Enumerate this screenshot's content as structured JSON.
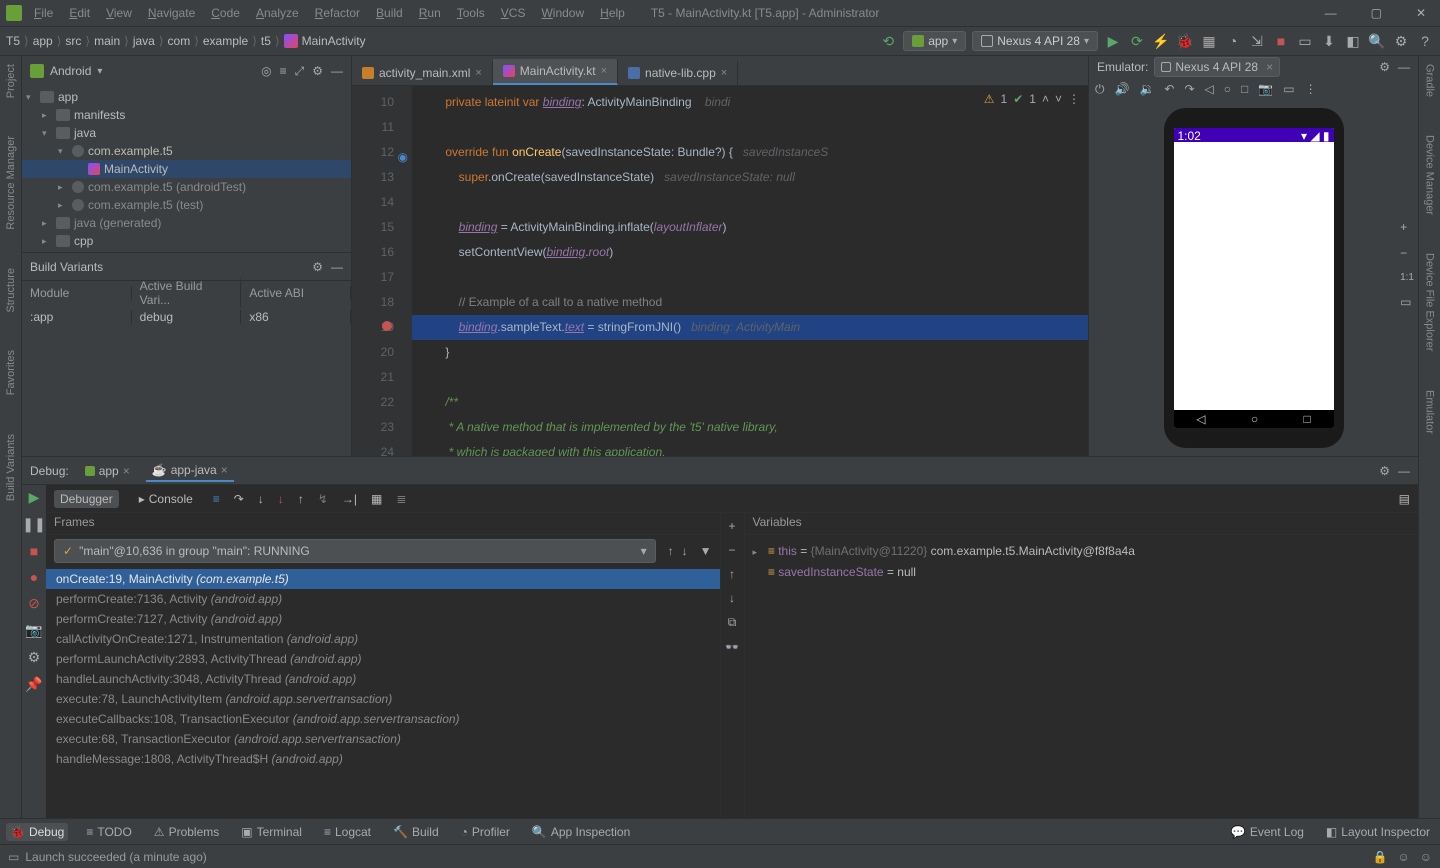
{
  "window": {
    "title": "T5 - MainActivity.kt [T5.app] - Administrator"
  },
  "menubar": [
    "File",
    "Edit",
    "View",
    "Navigate",
    "Code",
    "Analyze",
    "Refactor",
    "Build",
    "Run",
    "Tools",
    "VCS",
    "Window",
    "Help"
  ],
  "breadcrumbs": [
    "T5",
    "app",
    "src",
    "main",
    "java",
    "com",
    "example",
    "t5",
    "MainActivity"
  ],
  "run_config": {
    "app": "app",
    "device": "Nexus 4 API 28"
  },
  "project": {
    "header": "Android",
    "tree": [
      {
        "label": "app",
        "icon": "folder",
        "depth": 0,
        "open": true
      },
      {
        "label": "manifests",
        "icon": "folder",
        "depth": 1,
        "open": false
      },
      {
        "label": "java",
        "icon": "folder",
        "depth": 1,
        "open": true
      },
      {
        "label": "com.example.t5",
        "icon": "pkg",
        "depth": 2,
        "open": true
      },
      {
        "label": "MainActivity",
        "icon": "kfile",
        "depth": 3,
        "open": false,
        "sel": true
      },
      {
        "label": "com.example.t5 (androidTest)",
        "icon": "pkg",
        "depth": 2,
        "open": false,
        "dim": true
      },
      {
        "label": "com.example.t5 (test)",
        "icon": "pkg",
        "depth": 2,
        "open": false,
        "dim": true
      },
      {
        "label": "java (generated)",
        "icon": "folder",
        "depth": 1,
        "open": false,
        "dim": true
      },
      {
        "label": "cpp",
        "icon": "folder",
        "depth": 1,
        "open": false
      }
    ]
  },
  "build_variants": {
    "title": "Build Variants",
    "headers": [
      "Module",
      "Active Build Vari...",
      "Active ABI"
    ],
    "row": [
      ":app",
      "debug",
      "x86"
    ]
  },
  "tabs": [
    {
      "name": "activity_main.xml",
      "icon": "xml"
    },
    {
      "name": "MainActivity.kt",
      "icon": "kt",
      "active": true
    },
    {
      "name": "native-lib.cpp",
      "icon": "cpp"
    }
  ],
  "gutter": [
    "10",
    "11",
    "12",
    "13",
    "14",
    "15",
    "16",
    "17",
    "18",
    "19",
    "20",
    "21",
    "22",
    "23",
    "24"
  ],
  "code_indicators": {
    "warn": "1",
    "ok": "1"
  },
  "emulator": {
    "label": "Emulator:",
    "device": "Nexus 4 API 28",
    "time": "1:02"
  },
  "left_tools": [
    "Project",
    "Resource Manager",
    "Structure",
    "Favorites",
    "Build Variants"
  ],
  "right_tools": [
    "Gradle",
    "Device Manager",
    "Device File Explorer",
    "Emulator"
  ],
  "debug": {
    "label": "Debug:",
    "tabs": [
      "app",
      "app-java"
    ],
    "subtabs": [
      "Debugger",
      "Console"
    ],
    "frames_hdr": "Frames",
    "thread": "\"main\"@10,636 in group \"main\": RUNNING",
    "frames": [
      {
        "m": "onCreate:19, MainActivity ",
        "p": "(com.example.t5)",
        "hl": true
      },
      {
        "m": "performCreate:7136, Activity ",
        "p": "(android.app)"
      },
      {
        "m": "performCreate:7127, Activity ",
        "p": "(android.app)"
      },
      {
        "m": "callActivityOnCreate:1271, Instrumentation ",
        "p": "(android.app)"
      },
      {
        "m": "performLaunchActivity:2893, ActivityThread ",
        "p": "(android.app)"
      },
      {
        "m": "handleLaunchActivity:3048, ActivityThread ",
        "p": "(android.app)"
      },
      {
        "m": "execute:78, LaunchActivityItem ",
        "p": "(android.app.servertransaction)"
      },
      {
        "m": "executeCallbacks:108, TransactionExecutor ",
        "p": "(android.app.servertransaction)"
      },
      {
        "m": "execute:68, TransactionExecutor ",
        "p": "(android.app.servertransaction)"
      },
      {
        "m": "handleMessage:1808, ActivityThread$H ",
        "p": "(android.app)"
      }
    ],
    "vars_hdr": "Variables",
    "vars": [
      {
        "name": "this",
        "eq": " = ",
        "dim": "{MainActivity@11220} ",
        "val": "com.example.t5.MainActivity@f8f8a4a",
        "exp": true
      },
      {
        "name": "savedInstanceState",
        "eq": " = ",
        "val": "null"
      }
    ]
  },
  "bottom": [
    "Debug",
    "TODO",
    "Problems",
    "Terminal",
    "Logcat",
    "Build",
    "Profiler",
    "App Inspection"
  ],
  "bottom_right": [
    "Event Log",
    "Layout Inspector"
  ],
  "status": "Launch succeeded (a minute ago)"
}
